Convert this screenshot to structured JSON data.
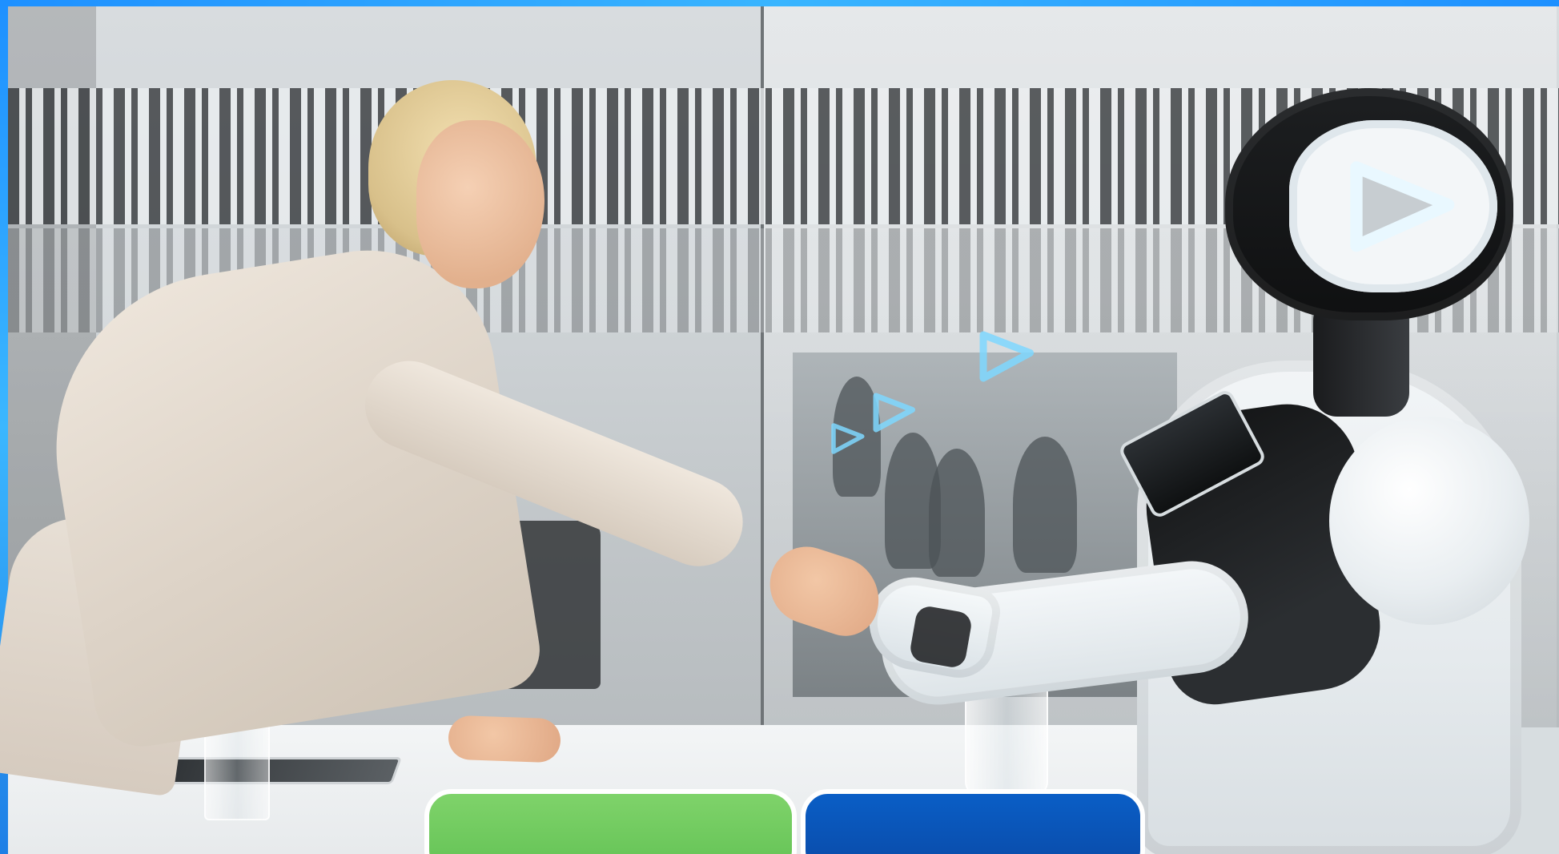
{
  "buttons": [
    {
      "label": ""
    },
    {
      "label": ""
    }
  ],
  "colors": {
    "frame_accent": "#1e90ff",
    "button_green": "#63c255",
    "button_blue": "#0a4aa7"
  }
}
